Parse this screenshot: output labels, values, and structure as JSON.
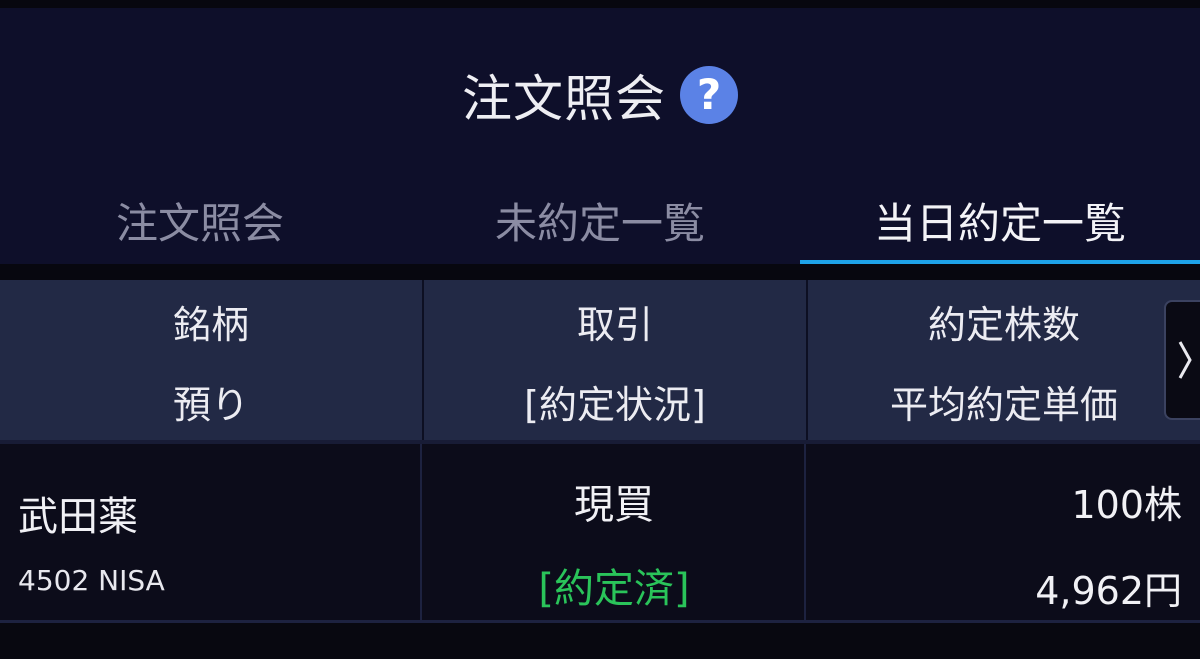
{
  "header": {
    "title": "注文照会",
    "help_icon": "question-circle-icon"
  },
  "tabs": [
    {
      "label": "注文照会",
      "active": false
    },
    {
      "label": "未約定一覧",
      "active": false
    },
    {
      "label": "当日約定一覧",
      "active": true
    }
  ],
  "table": {
    "columns": [
      {
        "line1": "銘柄",
        "line2": "預り"
      },
      {
        "line1": "取引",
        "line2": "[約定状況]"
      },
      {
        "line1": "約定株数",
        "line2": "平均約定単価"
      }
    ],
    "scroll_icon": "chevron-right-icon",
    "rows": [
      {
        "name": "武田薬",
        "code": "4502 NISA",
        "trade_type": "現買",
        "status": "[約定済]",
        "quantity": "100株",
        "price": "4,962円"
      }
    ]
  },
  "colors": {
    "header_bg": "#0e0f2a",
    "accent": "#1ea3ea",
    "status_green": "#2ac45a",
    "help_blue": "#5b82e6"
  }
}
